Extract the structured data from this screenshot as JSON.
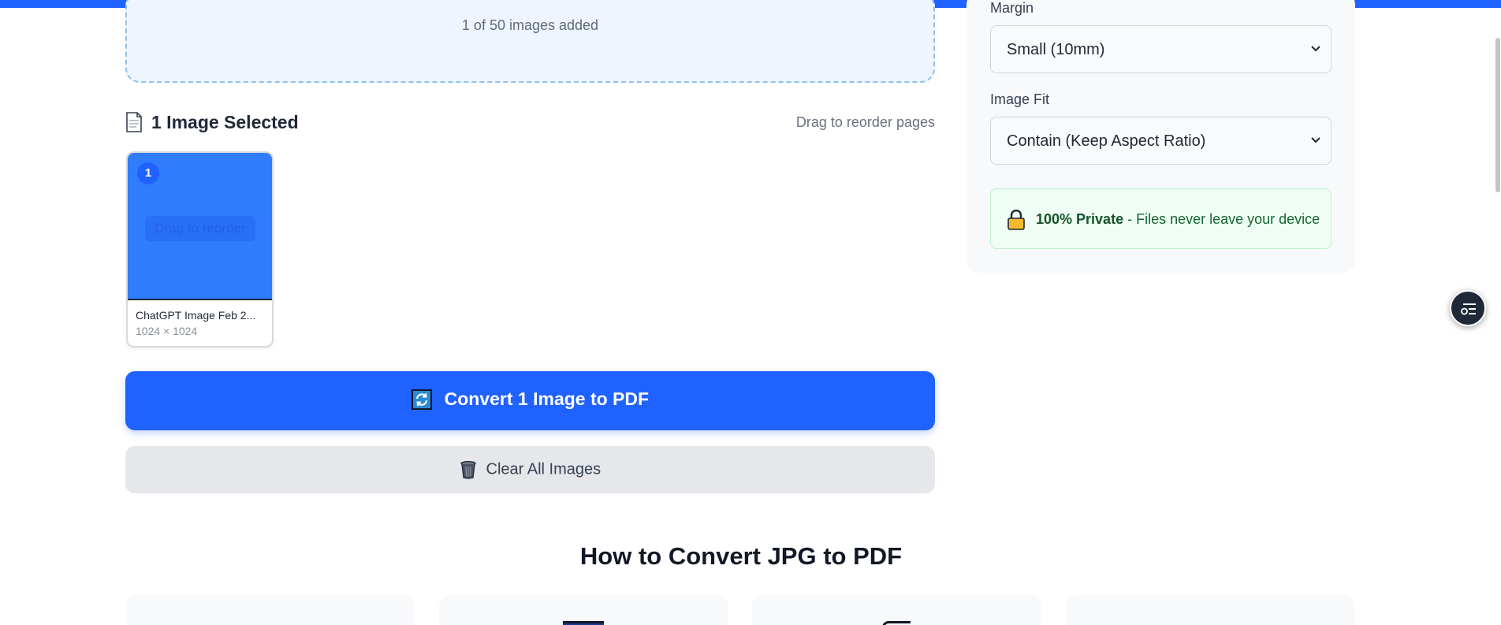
{
  "upload": {
    "count_text": "1 of 50 images added"
  },
  "selection": {
    "title": "1 Image Selected",
    "reorder_hint": "Drag to reorder pages"
  },
  "thumbnails": [
    {
      "badge": "1",
      "overlay_text": "Drag to reorder",
      "filename": "ChatGPT Image Feb 2...",
      "dimensions": "1024 × 1024"
    }
  ],
  "actions": {
    "convert_label": "Convert 1 Image to PDF",
    "clear_label": "Clear All Images"
  },
  "howto": {
    "title": "How to Convert JPG to PDF"
  },
  "settings": {
    "margin_label": "Margin",
    "margin_value": "Small (10mm)",
    "fit_label": "Image Fit",
    "fit_value": "Contain (Keep Aspect Ratio)"
  },
  "privacy": {
    "strong": "100% Private",
    "text": " - Files never leave your device"
  },
  "colors": {
    "accent": "#1f62ff",
    "thumb_fill": "#2f7dfc",
    "privacy_bg": "#effdf4",
    "privacy_text": "#166534"
  },
  "icons": {
    "document": "document-icon",
    "convert": "convert-icon",
    "trash": "trash-icon",
    "lock": "lock-icon",
    "float": "menu-settings-icon"
  }
}
